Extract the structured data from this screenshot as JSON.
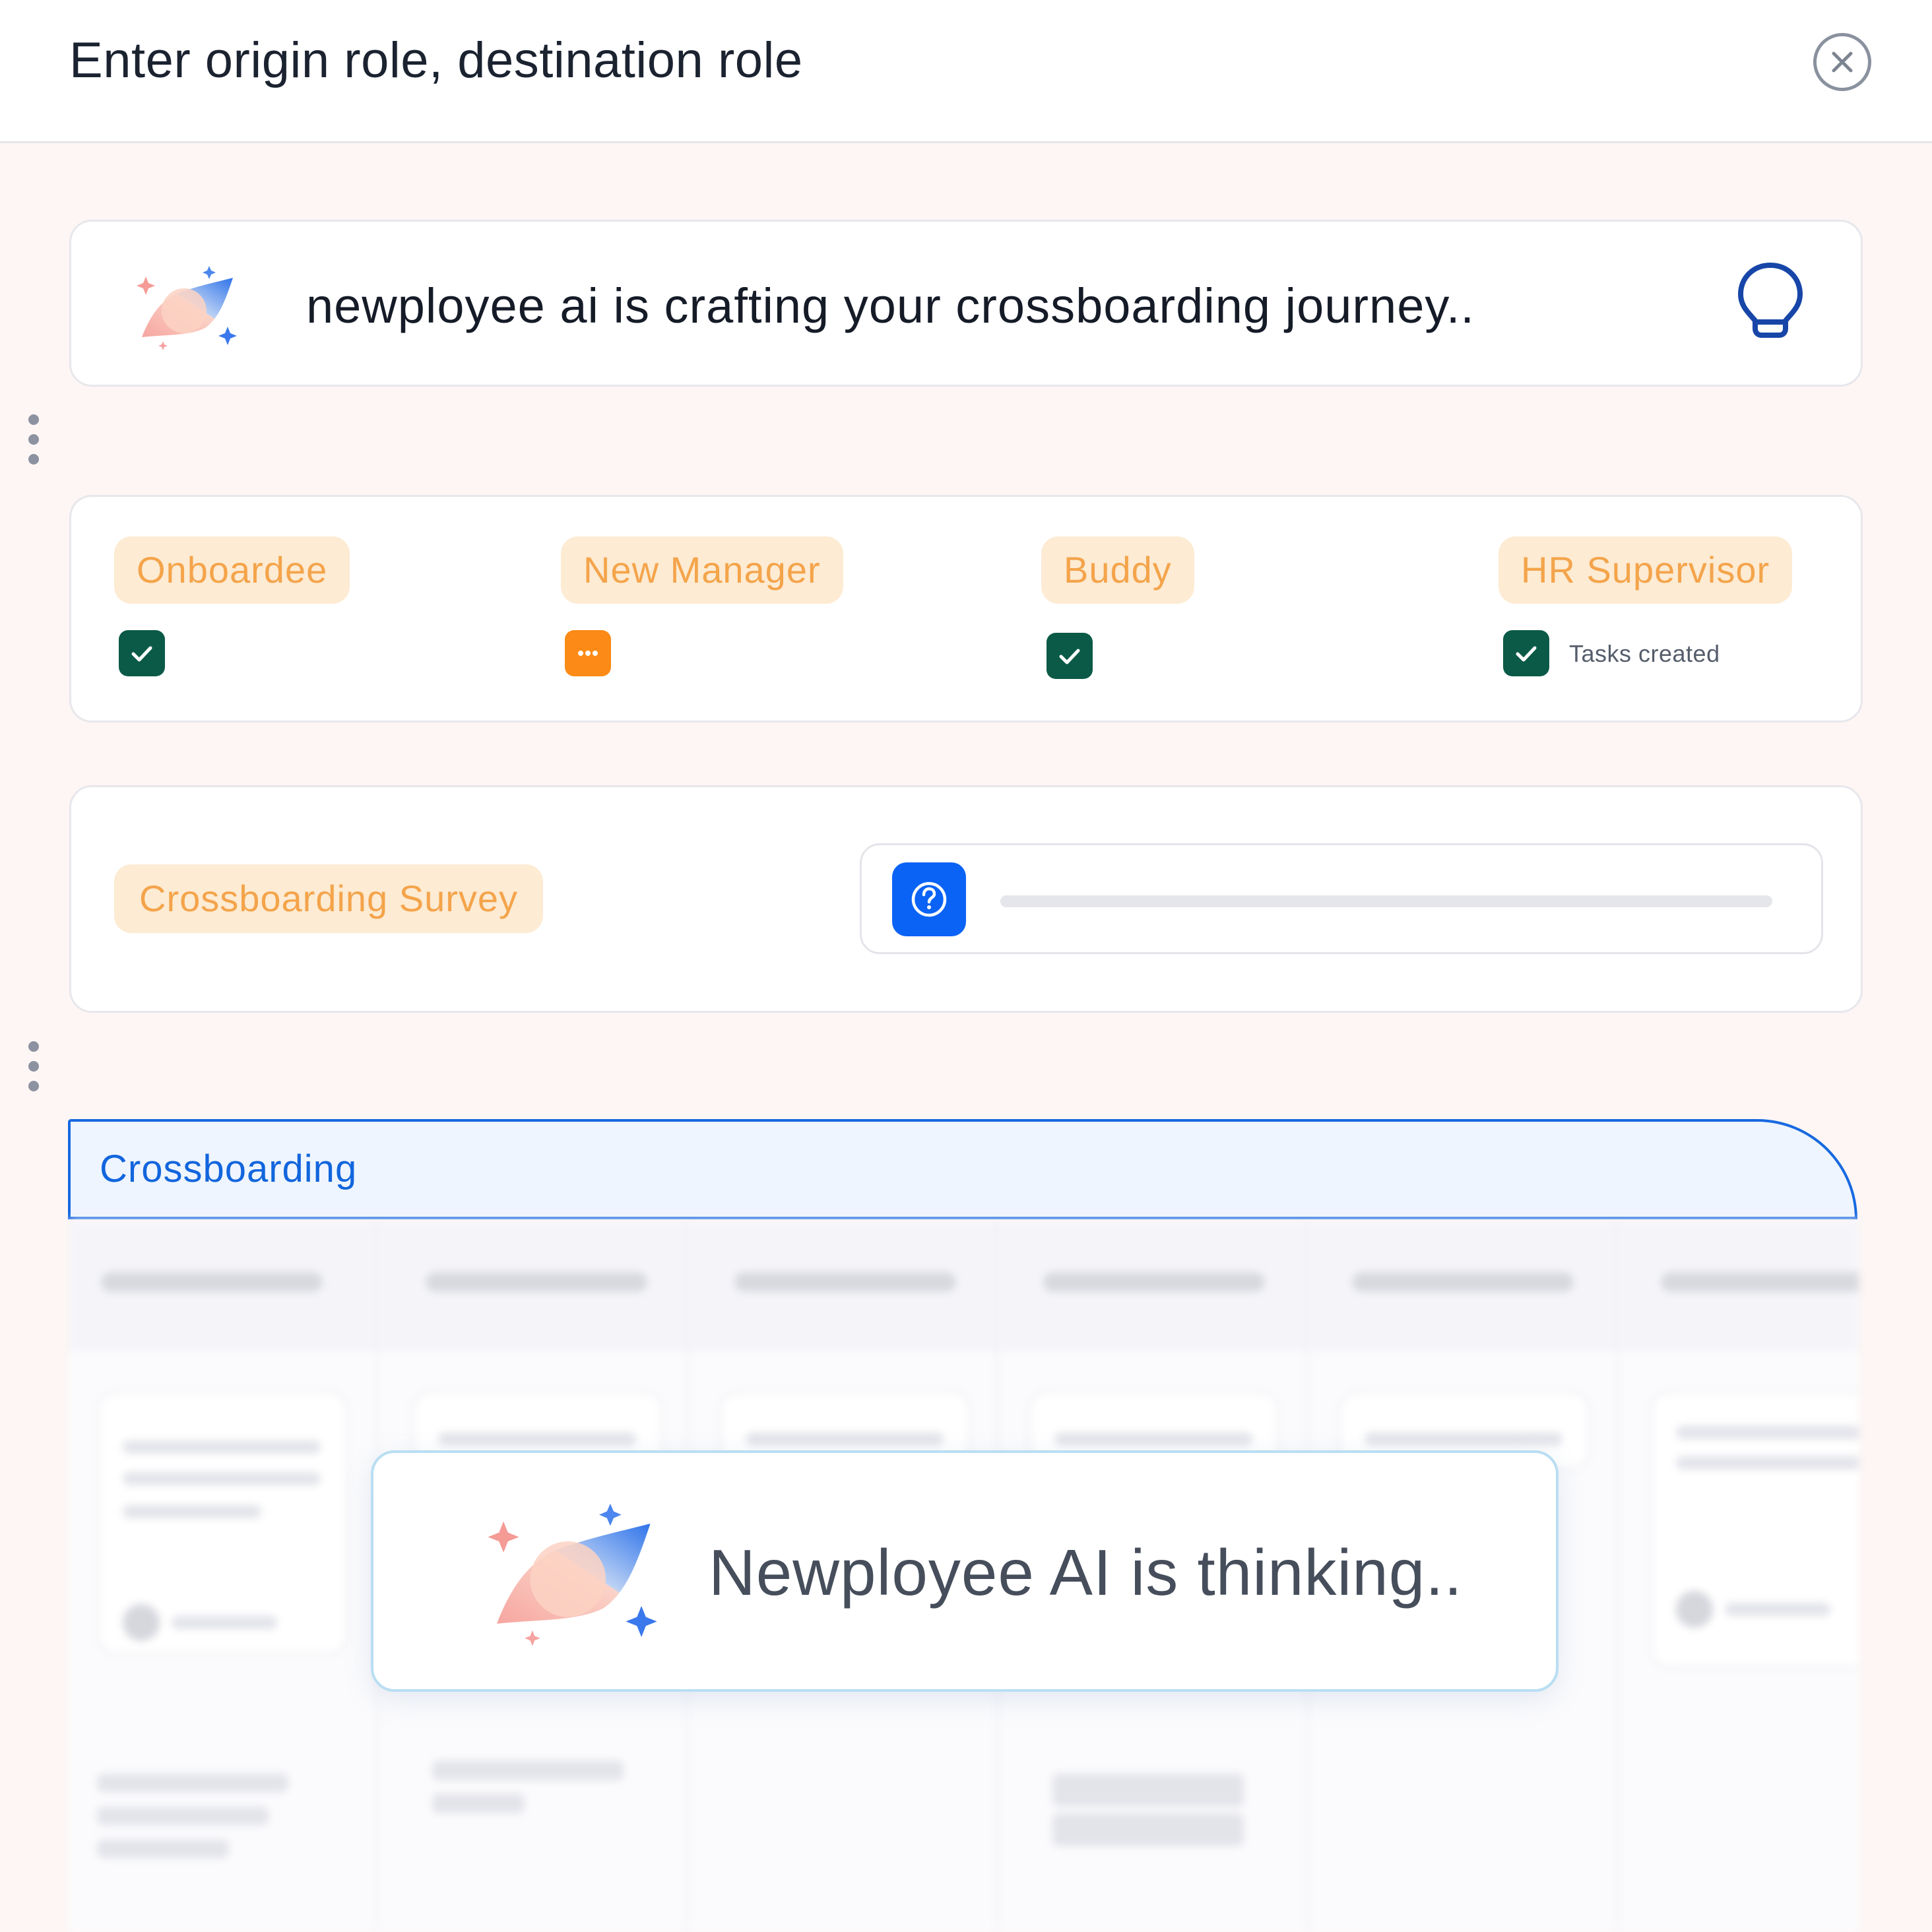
{
  "header": {
    "title": "Enter origin role, destination role",
    "close_icon": "close-icon"
  },
  "ai_status": {
    "message": "newployee ai is crafting your crossboarding journey..",
    "logo_icon": "newployee-ai-logo",
    "hint_icon": "lightbulb-icon"
  },
  "roles": [
    {
      "label": "Onboardee",
      "status": "done",
      "status_text": ""
    },
    {
      "label": "New Manager",
      "status": "pending",
      "status_text": ""
    },
    {
      "label": "Buddy",
      "status": "done",
      "status_text": ""
    },
    {
      "label": "HR Supervisor",
      "status": "done",
      "status_text": "Tasks created"
    }
  ],
  "survey": {
    "label": "Crossboarding Survey",
    "help_icon": "question-icon"
  },
  "board": {
    "tab_label": "Crossboarding"
  },
  "thinking": {
    "message": "Newployee AI is thinking.."
  },
  "colors": {
    "accent": "#0b63f5",
    "chip_bg": "#fdebd3",
    "chip_text": "#f4a44b",
    "done": "#0b5a47",
    "pending": "#fb8a16",
    "tab_border": "#1769e0"
  }
}
